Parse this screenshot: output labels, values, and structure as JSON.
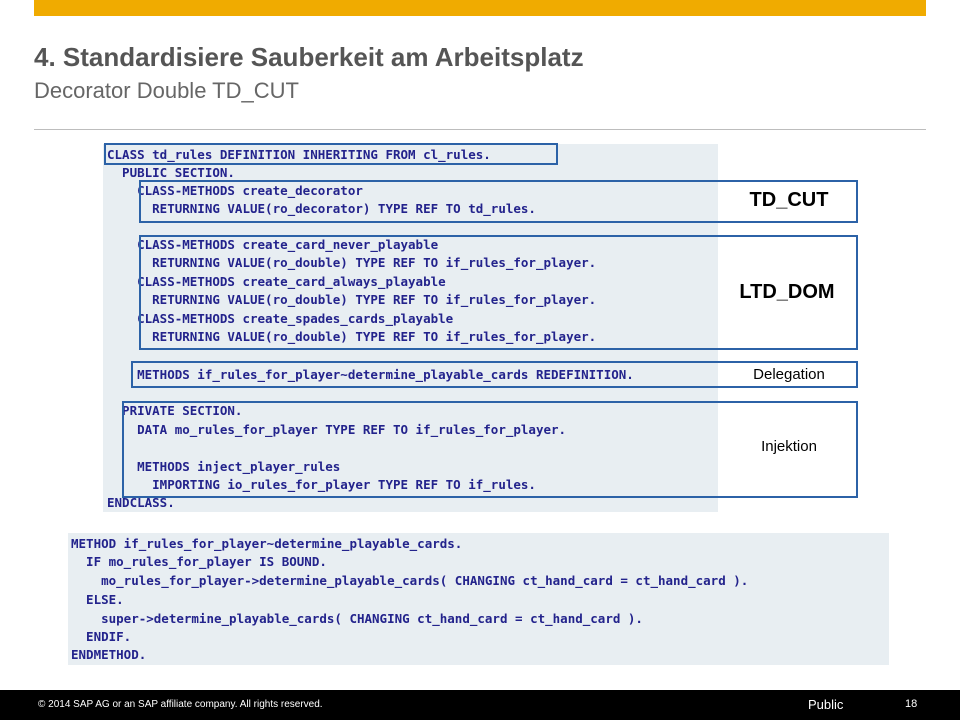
{
  "slide": {
    "title": "4. Standardisiere Sauberkeit am Arbeitsplatz",
    "subtitle": "Decorator Double TD_CUT"
  },
  "code_top": [
    "CLASS td_rules DEFINITION INHERITING FROM cl_rules.",
    "  PUBLIC SECTION.",
    "    CLASS-METHODS create_decorator",
    "      RETURNING VALUE(ro_decorator) TYPE REF TO td_rules.",
    "",
    "    CLASS-METHODS create_card_never_playable",
    "      RETURNING VALUE(ro_double) TYPE REF TO if_rules_for_player.",
    "    CLASS-METHODS create_card_always_playable",
    "      RETURNING VALUE(ro_double) TYPE REF TO if_rules_for_player.",
    "    CLASS-METHODS create_spades_cards_playable",
    "      RETURNING VALUE(ro_double) TYPE REF TO if_rules_for_player.",
    "",
    "    METHODS if_rules_for_player~determine_playable_cards REDEFINITION.",
    "",
    "  PRIVATE SECTION.",
    "    DATA mo_rules_for_player TYPE REF TO if_rules_for_player.",
    "",
    "    METHODS inject_player_rules",
    "      IMPORTING io_rules_for_player TYPE REF TO if_rules.",
    "ENDCLASS."
  ],
  "code_bottom": [
    "METHOD if_rules_for_player~determine_playable_cards.",
    "  IF mo_rules_for_player IS BOUND.",
    "    mo_rules_for_player->determine_playable_cards( CHANGING ct_hand_card = ct_hand_card ).",
    "  ELSE.",
    "    super->determine_playable_cards( CHANGING ct_hand_card = ct_hand_card ).",
    "  ENDIF.",
    "ENDMETHOD."
  ],
  "labels": {
    "td_cut": "TD_CUT",
    "ltd_dom": "LTD_DOM",
    "delegation": "Delegation",
    "injektion": "Injektion"
  },
  "footer": {
    "copyright": "© 2014 SAP AG or an SAP affiliate company. All rights reserved.",
    "classification": "Public",
    "page_number": "18"
  },
  "colors": {
    "accent_bar": "#f0ab00",
    "frame": "#2c62a7",
    "code_bg": "#e8eef2",
    "footer_bg": "#000000"
  }
}
